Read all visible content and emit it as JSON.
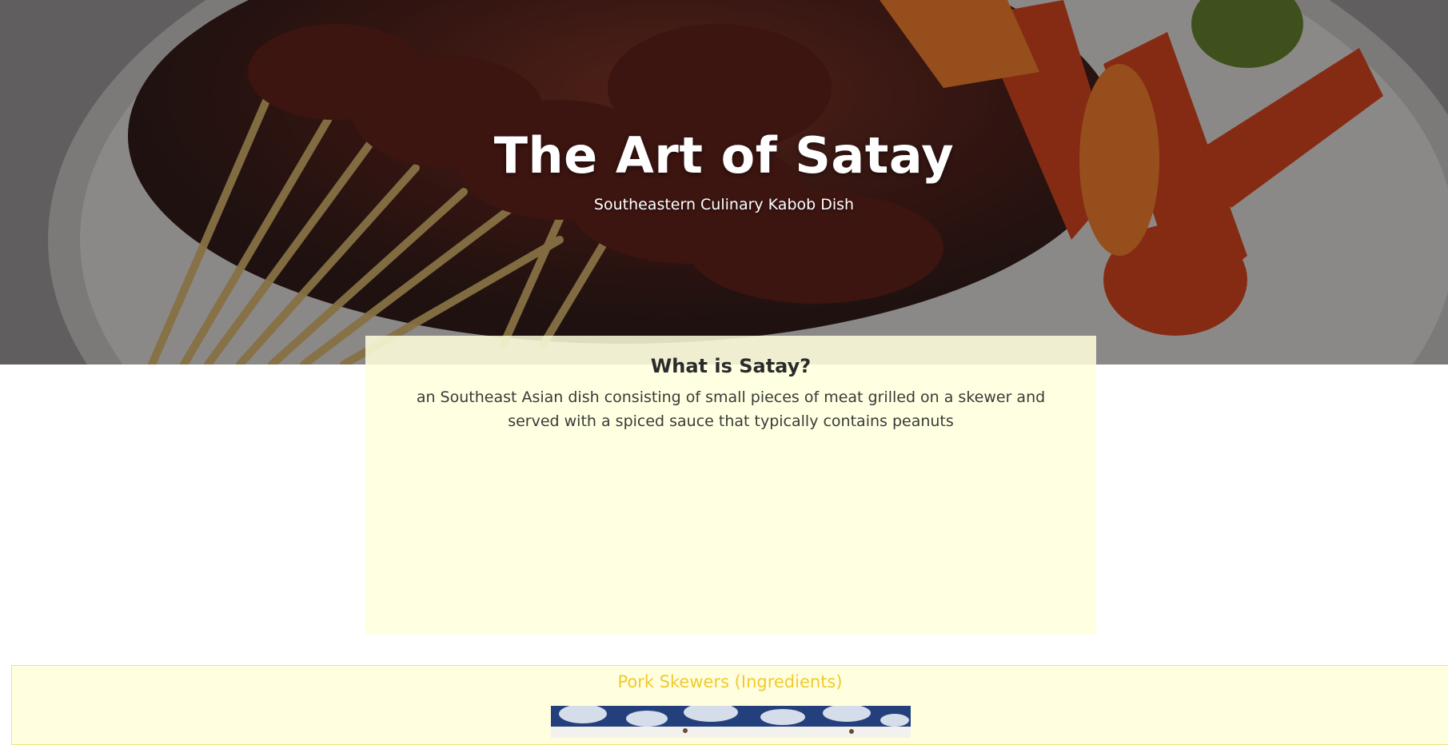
{
  "hero": {
    "title": "The Art of Satay",
    "subtitle": "Southeastern Culinary Kabob Dish"
  },
  "about": {
    "heading": "What is Satay?",
    "text": "an Southeast Asian dish consisting of small pieces of meat grilled on a skewer and served with a spiced sauce that typically contains peanuts"
  },
  "ingredients": {
    "title": "Pork Skewers (Ingredients)"
  },
  "colors": {
    "card_background": "#ffffdc",
    "ingredients_title": "#f2c92b",
    "ingredients_border": "#f1e27a"
  }
}
